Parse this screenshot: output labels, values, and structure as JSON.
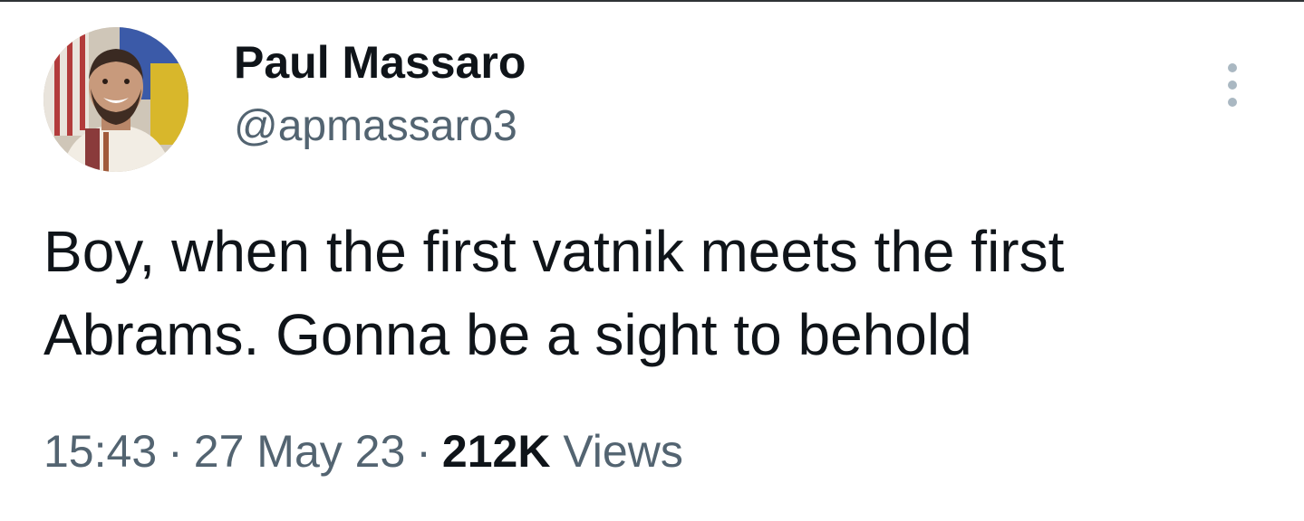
{
  "tweet": {
    "author": {
      "display_name": "Paul Massaro",
      "handle": "@apmassaro3",
      "avatar_icon": "profile-photo"
    },
    "more_icon": "more-vertical-icon",
    "text_lines": [
      "Boy, when the first vatnik meets the first",
      "Abrams. Gonna be a sight to behold"
    ],
    "meta": {
      "time": "15:43",
      "date": "27 May 23",
      "separator": "·",
      "view_count": "212K",
      "views_label": "Views"
    }
  },
  "colors": {
    "text_primary": "#0f1419",
    "text_secondary": "#536471",
    "more_dots": "#aab8c2"
  }
}
